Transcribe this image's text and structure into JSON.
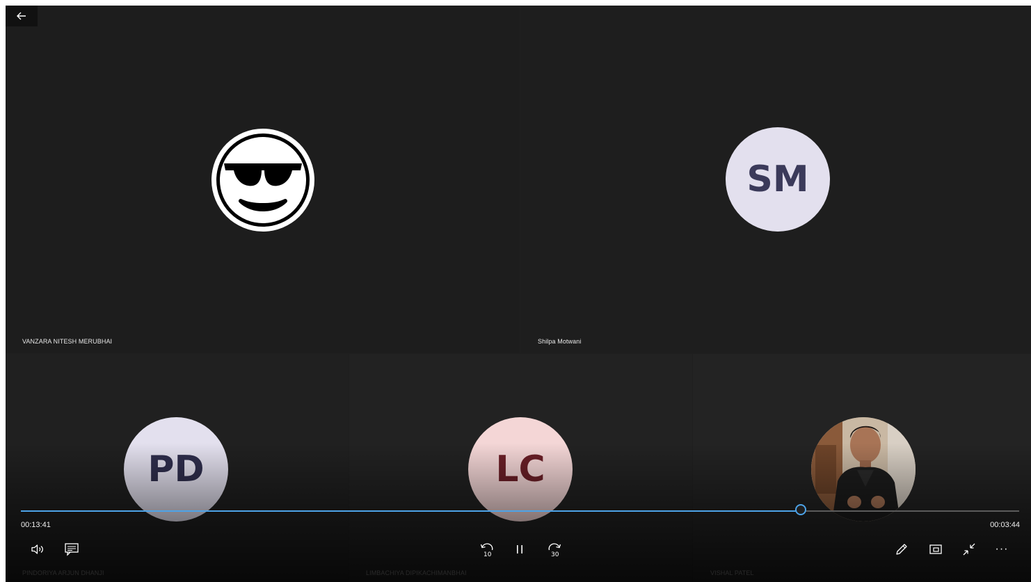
{
  "participants": [
    {
      "name": "VANZARA NITESH MERUBHAI",
      "avatar": "cool-sunglasses-emoji"
    },
    {
      "name": "Shilpa Motwani",
      "initials": "SM",
      "avatar_bg": "#e3e0ee",
      "avatar_fg": "#3b3a5a"
    },
    {
      "name": "PINDORIYA ARJUN DHANJI",
      "initials": "PD",
      "avatar_bg": "#e3e0ee",
      "avatar_fg": "#2f2e4d"
    },
    {
      "name": "LIMBACHIYA DIPIKACHIMANBHAI",
      "initials": "LC",
      "avatar_bg": "#f4d6d6",
      "avatar_fg": "#6b1f27"
    },
    {
      "name": "VISHAL PATEL",
      "avatar": "profile-photo"
    }
  ],
  "player": {
    "elapsed": "00:13:41",
    "remaining": "00:03:44",
    "progress": 0.781,
    "accent": "#4da3e8"
  },
  "icons": {
    "back": "back-arrow-icon",
    "volume": "volume-icon",
    "captions": "captions-icon",
    "skip_back": "skip-back-10-icon",
    "pause": "pause-icon",
    "skip_forward": "skip-forward-30-icon",
    "draw": "pen-icon",
    "mini_view": "picture-in-picture-icon",
    "exit_fullscreen": "exit-fullscreen-icon",
    "more": "more-icon"
  },
  "skip_back_seconds": "10",
  "skip_forward_seconds": "30",
  "more_glyph": "···"
}
